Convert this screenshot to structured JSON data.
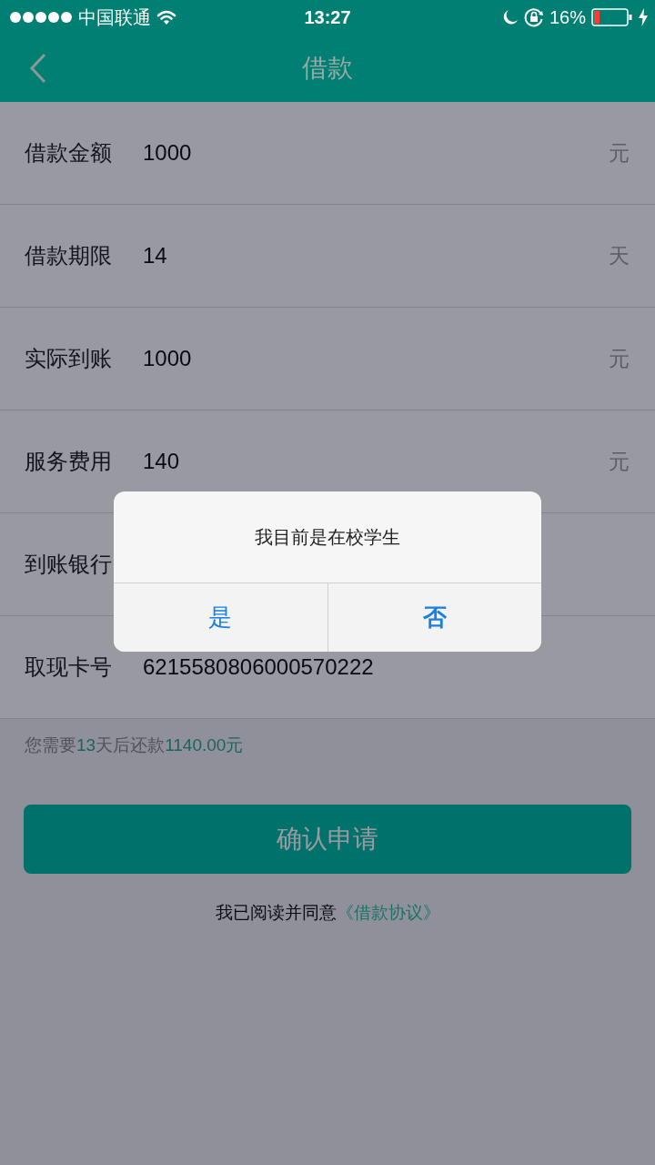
{
  "status_bar": {
    "carrier": "中国联通",
    "time": "13:27",
    "battery": "16%"
  },
  "nav": {
    "title": "借款"
  },
  "fields": [
    {
      "label": "借款金额",
      "value": "1000",
      "unit": "元"
    },
    {
      "label": "借款期限",
      "value": "14",
      "unit": "天"
    },
    {
      "label": "实际到账",
      "value": "1000",
      "unit": "元"
    },
    {
      "label": "服务费用",
      "value": "140",
      "unit": "元"
    },
    {
      "label": "到账银行"
    },
    {
      "label": "取现卡号",
      "value": "6215580806000570222"
    }
  ],
  "repay_notice": [
    {
      "text": "您需要",
      "highlight": false
    },
    {
      "text": "13",
      "highlight": true
    },
    {
      "text": "天后还款",
      "highlight": false
    },
    {
      "text": "1140.00元",
      "highlight": true
    }
  ],
  "submit_button": "确认申请",
  "agreement": {
    "text": "我已阅读并同意",
    "link": "《借款协议》"
  },
  "dialog": {
    "message": "我目前是在校学生",
    "buttons": [
      "是",
      "否"
    ]
  }
}
